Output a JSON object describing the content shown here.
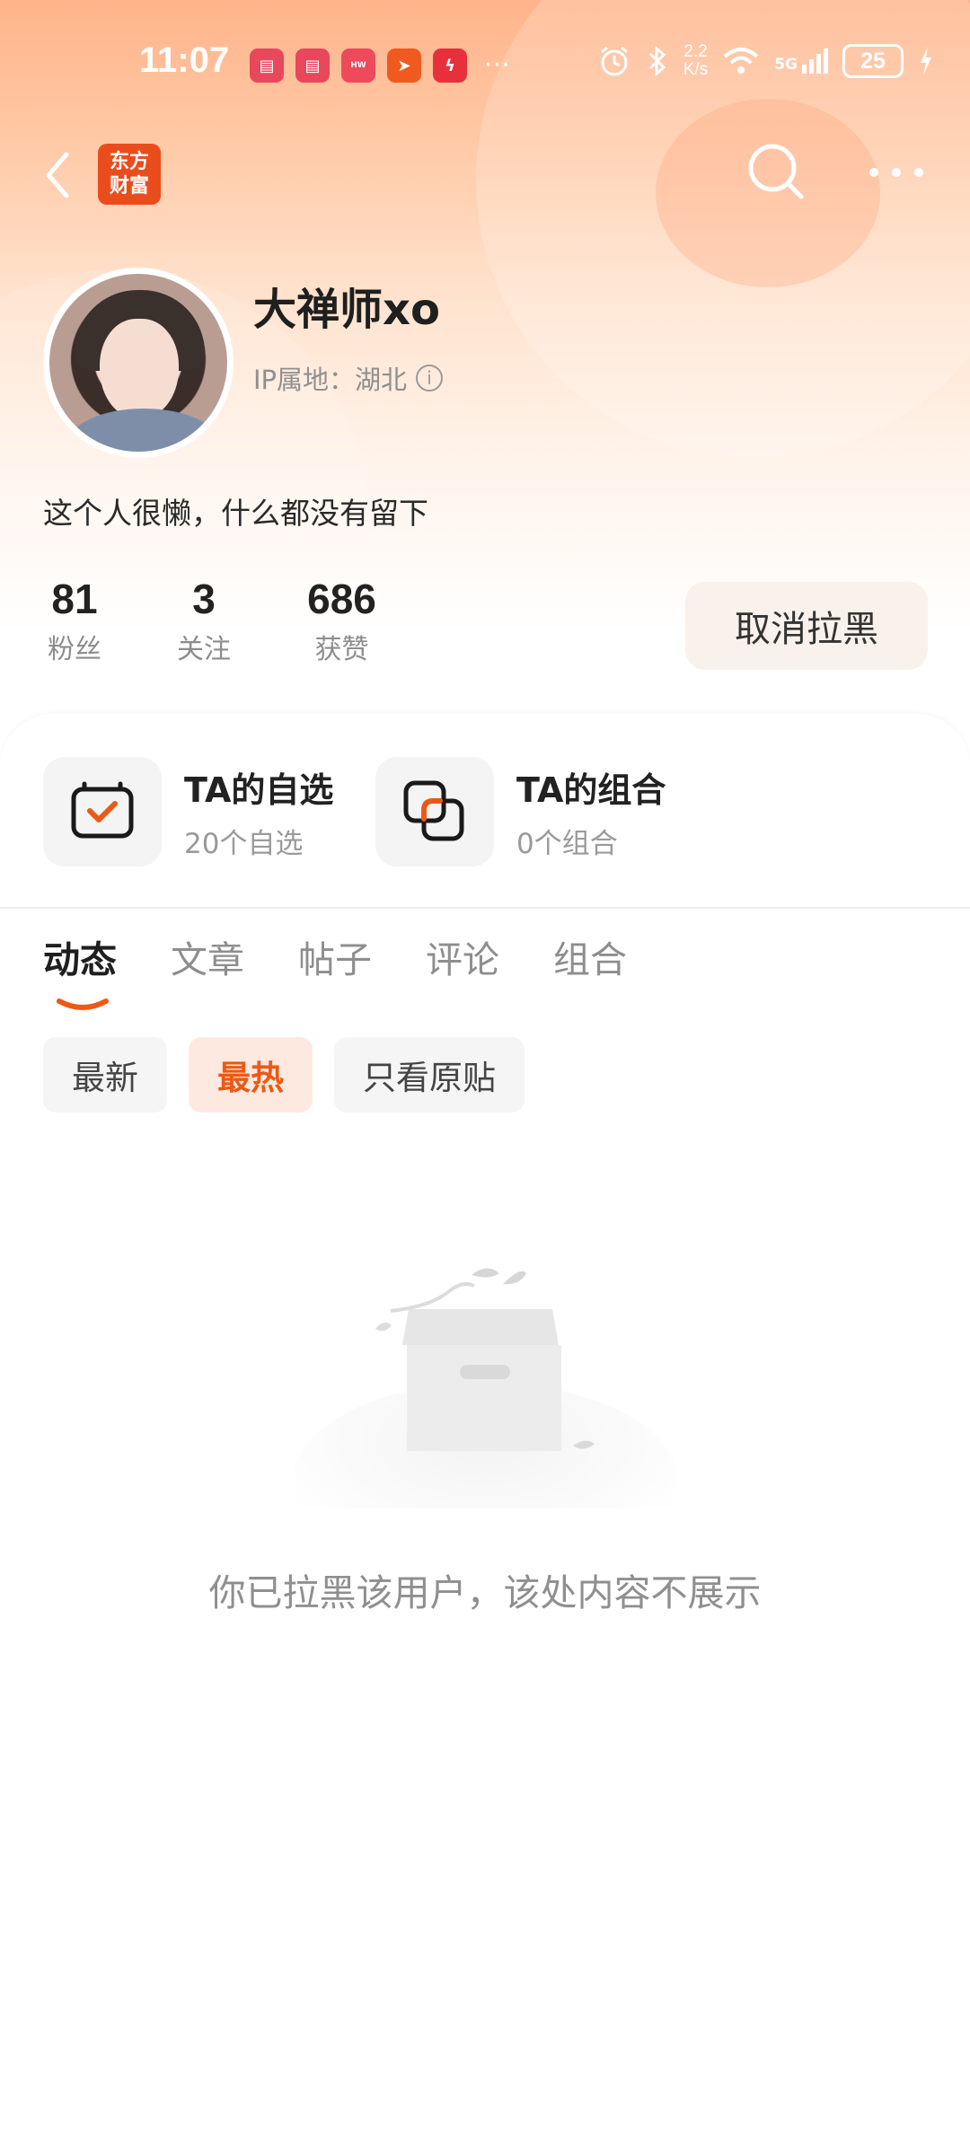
{
  "status_bar": {
    "time": "11:07",
    "net_speed_value": "2.2",
    "net_speed_unit": "K/s",
    "signal_label": "5G",
    "battery": "25"
  },
  "nav": {
    "logo_line1": "东方",
    "logo_line2": "财富"
  },
  "profile": {
    "username": "大禅师xo",
    "ip_location": "IP属地：湖北",
    "bio": "这个人很懒，什么都没有留下",
    "stats": [
      {
        "value": "81",
        "label": "粉丝"
      },
      {
        "value": "3",
        "label": "关注"
      },
      {
        "value": "686",
        "label": "获赞"
      }
    ],
    "unblock_label": "取消拉黑"
  },
  "features": [
    {
      "title": "TA的自选",
      "subtitle": "20个自选",
      "icon": "watchlist-icon"
    },
    {
      "title": "TA的组合",
      "subtitle": "0个组合",
      "icon": "portfolio-icon"
    }
  ],
  "tabs": [
    "动态",
    "文章",
    "帖子",
    "评论",
    "组合"
  ],
  "active_tab": "动态",
  "filters": [
    "最新",
    "最热",
    "只看原贴"
  ],
  "active_filter": "最热",
  "empty_message": "你已拉黑该用户，该处内容不展示",
  "colors": {
    "accent": "#ea5a16",
    "brand": "#ea4d1c",
    "header_gradient_top": "#ffb48a"
  }
}
